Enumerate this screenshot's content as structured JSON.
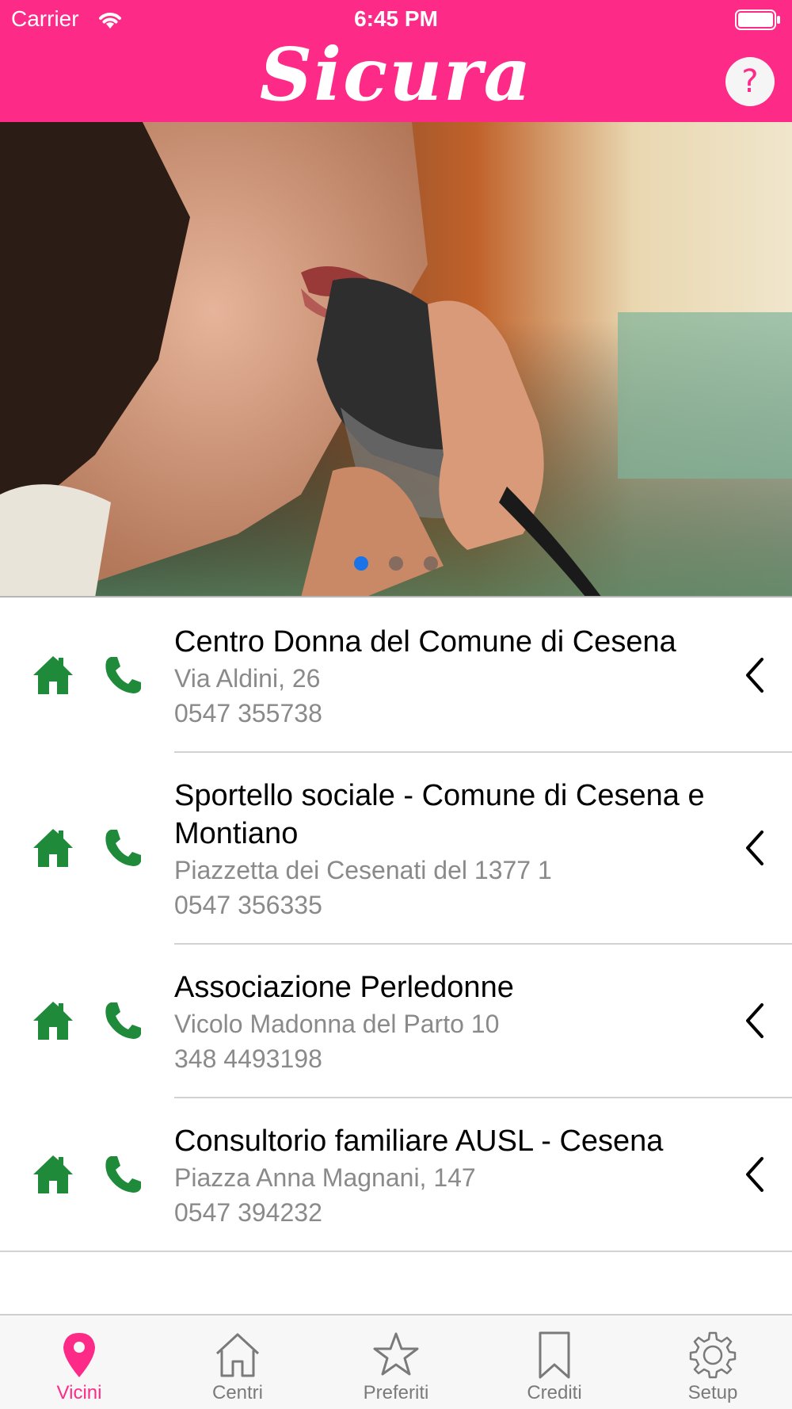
{
  "status_bar": {
    "carrier": "Carrier",
    "time": "6:45 PM"
  },
  "header": {
    "logo": "Sicura",
    "help_label": "?"
  },
  "colors": {
    "brand": "#FE2A87",
    "icon_green": "#1E8A3A",
    "page_dot_active": "#1A73E8",
    "page_dot_inactive": "#5a5a5a"
  },
  "banner": {
    "page_count": 3,
    "current_page": 1
  },
  "centers": [
    {
      "name": "Centro Donna del Comune di Cesena",
      "address": "Via Aldini, 26",
      "phone": "0547 355738"
    },
    {
      "name": "Sportello sociale - Comune di Cesena e Montiano",
      "address": "Piazzetta dei Cesenati del 1377 1",
      "phone": "0547 356335"
    },
    {
      "name": "Associazione Perledonne",
      "address": "Vicolo Madonna del Parto 10",
      "phone": "348 4493198"
    },
    {
      "name": "Consultorio familiare AUSL - Cesena",
      "address": "Piazza Anna Magnani, 147",
      "phone": "0547 394232"
    }
  ],
  "icons": {
    "home": "home-icon",
    "phone": "phone-icon",
    "chevron": "chevron-left-icon"
  },
  "tabs": [
    {
      "label": "Vicini",
      "icon": "map-pin-icon",
      "active": true
    },
    {
      "label": "Centri",
      "icon": "house-outline-icon",
      "active": false
    },
    {
      "label": "Preferiti",
      "icon": "star-outline-icon",
      "active": false
    },
    {
      "label": "Crediti",
      "icon": "bookmark-outline-icon",
      "active": false
    },
    {
      "label": "Setup",
      "icon": "gear-outline-icon",
      "active": false
    }
  ]
}
